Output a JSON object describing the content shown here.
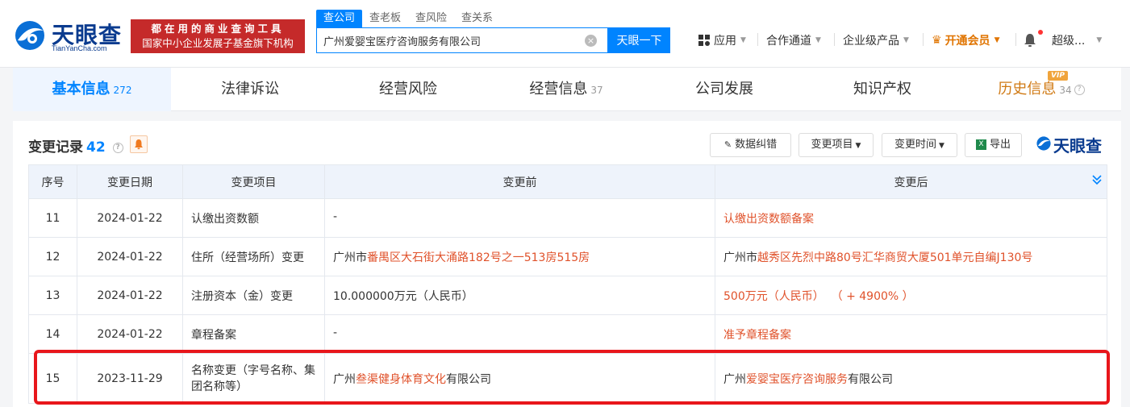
{
  "header": {
    "logo_text": "天眼查",
    "logo_sub": "TianYanCha.com",
    "slogan_line1": "都在用的商业查询工具",
    "slogan_line2": "国家中小企业发展子基金旗下机构",
    "search_tabs": [
      "查公司",
      "查老板",
      "查风险",
      "查关系"
    ],
    "search_value": "广州爱婴宝医疗咨询服务有限公司",
    "search_button": "天眼一下",
    "nav": {
      "apps": "应用",
      "partner": "合作通道",
      "enterprise": "企业级产品",
      "vip": "开通会员",
      "user": "超级..."
    }
  },
  "tabs": [
    {
      "label": "基本信息",
      "count": "272"
    },
    {
      "label": "法律诉讼",
      "count": ""
    },
    {
      "label": "经营风险",
      "count": ""
    },
    {
      "label": "经营信息",
      "count": "37"
    },
    {
      "label": "公司发展",
      "count": ""
    },
    {
      "label": "知识产权",
      "count": ""
    },
    {
      "label": "历史信息",
      "count": "34"
    }
  ],
  "vip_badge": "VIP",
  "section": {
    "title": "变更记录",
    "count": "42",
    "buttons": {
      "correct": "数据纠错",
      "item": "变更项目",
      "time": "变更时间",
      "export": "导出"
    },
    "brand": "天眼查"
  },
  "table": {
    "headers": [
      "序号",
      "变更日期",
      "变更项目",
      "变更前",
      "变更后"
    ],
    "rows": [
      {
        "no": "11",
        "date": "2024-01-22",
        "item": "认缴出资数额",
        "before": "-",
        "after": "认缴出资数额备案"
      },
      {
        "no": "12",
        "date": "2024-01-22",
        "item": "住所（经营场所）变更",
        "before_pre": "广州市",
        "before_hl": "番禺区大石街大涌路182号之一513房515房",
        "after_pre": "广州市",
        "after_hl": "越秀区先烈中路80号汇华商贸大厦501单元自编J130号"
      },
      {
        "no": "13",
        "date": "2024-01-22",
        "item": "注册资本（金）变更",
        "before": "10.000000万元（人民币）",
        "after": "500万元（人民币）  （ + 4900% ）"
      },
      {
        "no": "14",
        "date": "2024-01-22",
        "item": "章程备案",
        "before": "-",
        "after": "准予章程备案"
      },
      {
        "no": "15",
        "date": "2023-11-29",
        "item": "名称变更（字号名称、集团名称等）",
        "before_pre": "广州",
        "before_hl": "叁渠健身体育文化",
        "before_post": "有限公司",
        "after_pre": "广州",
        "after_hl": "爱婴宝医疗咨询服务",
        "after_post": "有限公司"
      }
    ]
  },
  "colors": {
    "primary": "#0084ff",
    "highlight_text": "#e0522b",
    "highlight_box": "#e8161b",
    "slogan_bg": "#c52a2a",
    "vip_text": "#e07400"
  }
}
